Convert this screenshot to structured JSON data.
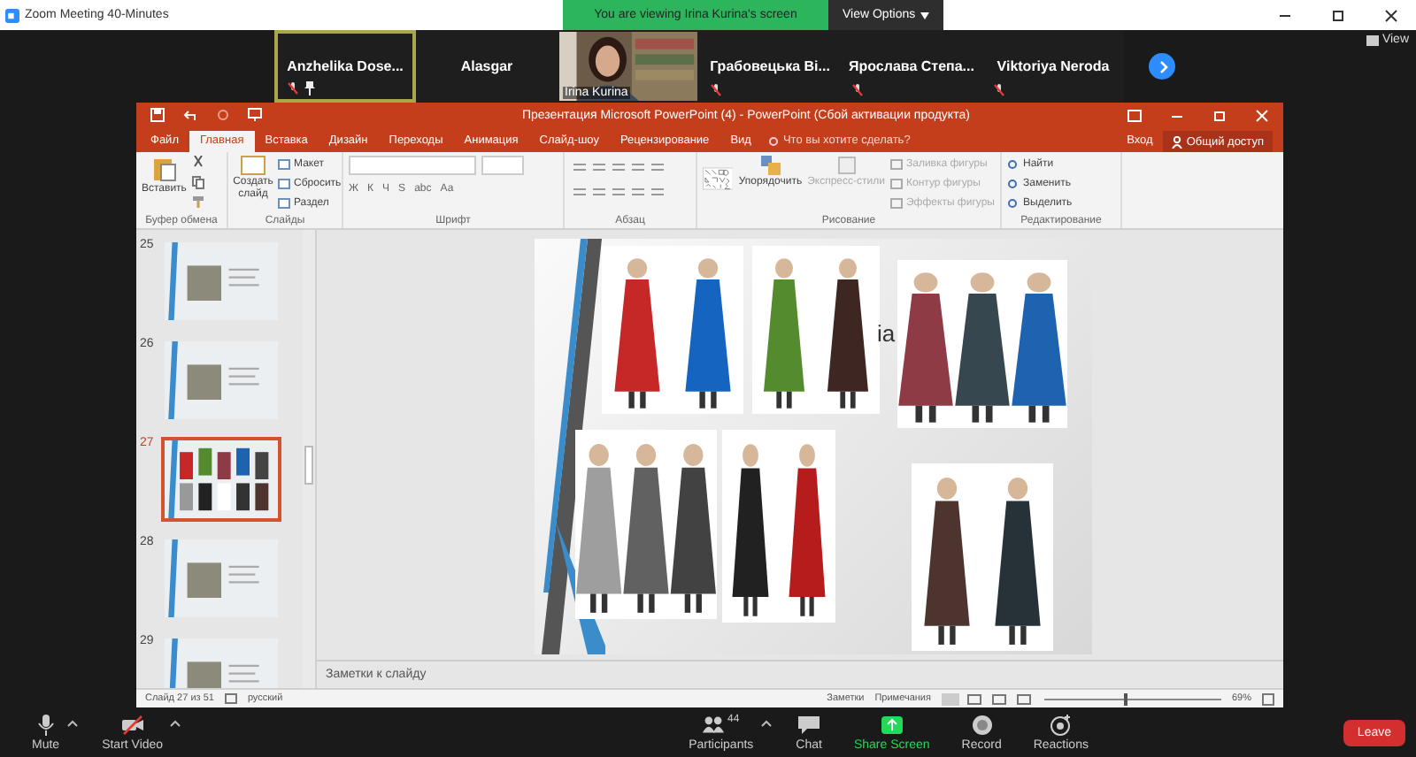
{
  "window": {
    "title": "Zoom Meeting 40-Minutes"
  },
  "share_banner": {
    "text": "You are viewing Irina Kurina's screen",
    "view_options": "View Options"
  },
  "participants": [
    {
      "name": "Anzhelika  Dose...",
      "kind": "name",
      "muted": true,
      "pinned": true,
      "active": true
    },
    {
      "name": "Alasgar",
      "kind": "name",
      "muted": false,
      "pinned": false,
      "active": false
    },
    {
      "name": "Irina Kurina",
      "kind": "video",
      "muted": false,
      "pinned": false,
      "active": false
    },
    {
      "name": "Грабовецька  Ві...",
      "kind": "name",
      "muted": true,
      "pinned": false,
      "active": false
    },
    {
      "name": "Ярослава  Степа...",
      "kind": "name",
      "muted": true,
      "pinned": false,
      "active": false
    },
    {
      "name": "Viktoriya Neroda",
      "kind": "name",
      "muted": true,
      "pinned": false,
      "active": false
    }
  ],
  "view_button": "View",
  "powerpoint": {
    "title": "Презентация Microsoft PowerPoint (4) - PowerPoint (Сбой активации продукта)",
    "tabs": [
      {
        "label": "Файл",
        "selected": false
      },
      {
        "label": "Главная",
        "selected": true
      },
      {
        "label": "Вставка",
        "selected": false
      },
      {
        "label": "Дизайн",
        "selected": false
      },
      {
        "label": "Переходы",
        "selected": false
      },
      {
        "label": "Анимация",
        "selected": false
      },
      {
        "label": "Слайд-шоу",
        "selected": false
      },
      {
        "label": "Рецензирование",
        "selected": false
      },
      {
        "label": "Вид",
        "selected": false
      }
    ],
    "tell_me": "Что вы хотите сделать?",
    "sign_in": "Вход",
    "share": "Общий доступ",
    "clipboard": {
      "label": "Буфер обмена",
      "paste": "Вставить"
    },
    "slides_group": {
      "label": "Слайды",
      "new_slide": "Создать слайд",
      "items": [
        "Макет",
        "Сбросить",
        "Раздел"
      ]
    },
    "font": {
      "label": "Шрифт",
      "buttons": [
        "Ж",
        "К",
        "Ч",
        "S",
        "abc",
        "Аа"
      ]
    },
    "paragraph": {
      "label": "Абзац"
    },
    "drawing": {
      "label": "Рисование",
      "arrange": "Упорядочить",
      "quick_styles": "Экспресс-стили",
      "items": [
        {
          "label": "Заливка фигуры",
          "disabled": true
        },
        {
          "label": "Контур фигуры",
          "disabled": true
        },
        {
          "label": "Эффекты фигуры",
          "disabled": true
        }
      ]
    },
    "editing": {
      "label": "Редактирование",
      "items": [
        "Найти",
        "Заменить",
        "Выделить"
      ]
    },
    "thumbnails": [
      {
        "number": "25",
        "selected": false
      },
      {
        "number": "26",
        "selected": false
      },
      {
        "number": "27",
        "selected": true
      },
      {
        "number": "28",
        "selected": false
      },
      {
        "number": "29",
        "selected": false
      }
    ],
    "slide": {
      "title_fragment": "ia"
    },
    "notes_placeholder": "Заметки к слайду",
    "status": {
      "slide": "Слайд 27 из 51",
      "language": "русский",
      "notes": "Заметки",
      "comments": "Примечания",
      "zoom": {
        "level": 0.45,
        "reading": "69%"
      }
    }
  },
  "toolbar": [
    {
      "label": "Mute",
      "kind": "mic",
      "caret": true
    },
    {
      "label": "Start Video",
      "kind": "video",
      "caret": true
    },
    {
      "label": "Participants",
      "kind": "participants",
      "count": "44",
      "caret": true
    },
    {
      "label": "Chat",
      "kind": "chat",
      "caret": false
    },
    {
      "label": "Share Screen",
      "kind": "share",
      "caret": false
    },
    {
      "label": "Record",
      "kind": "record",
      "caret": false
    },
    {
      "label": "Reactions",
      "kind": "reactions",
      "caret": false
    }
  ],
  "leave": "Leave"
}
